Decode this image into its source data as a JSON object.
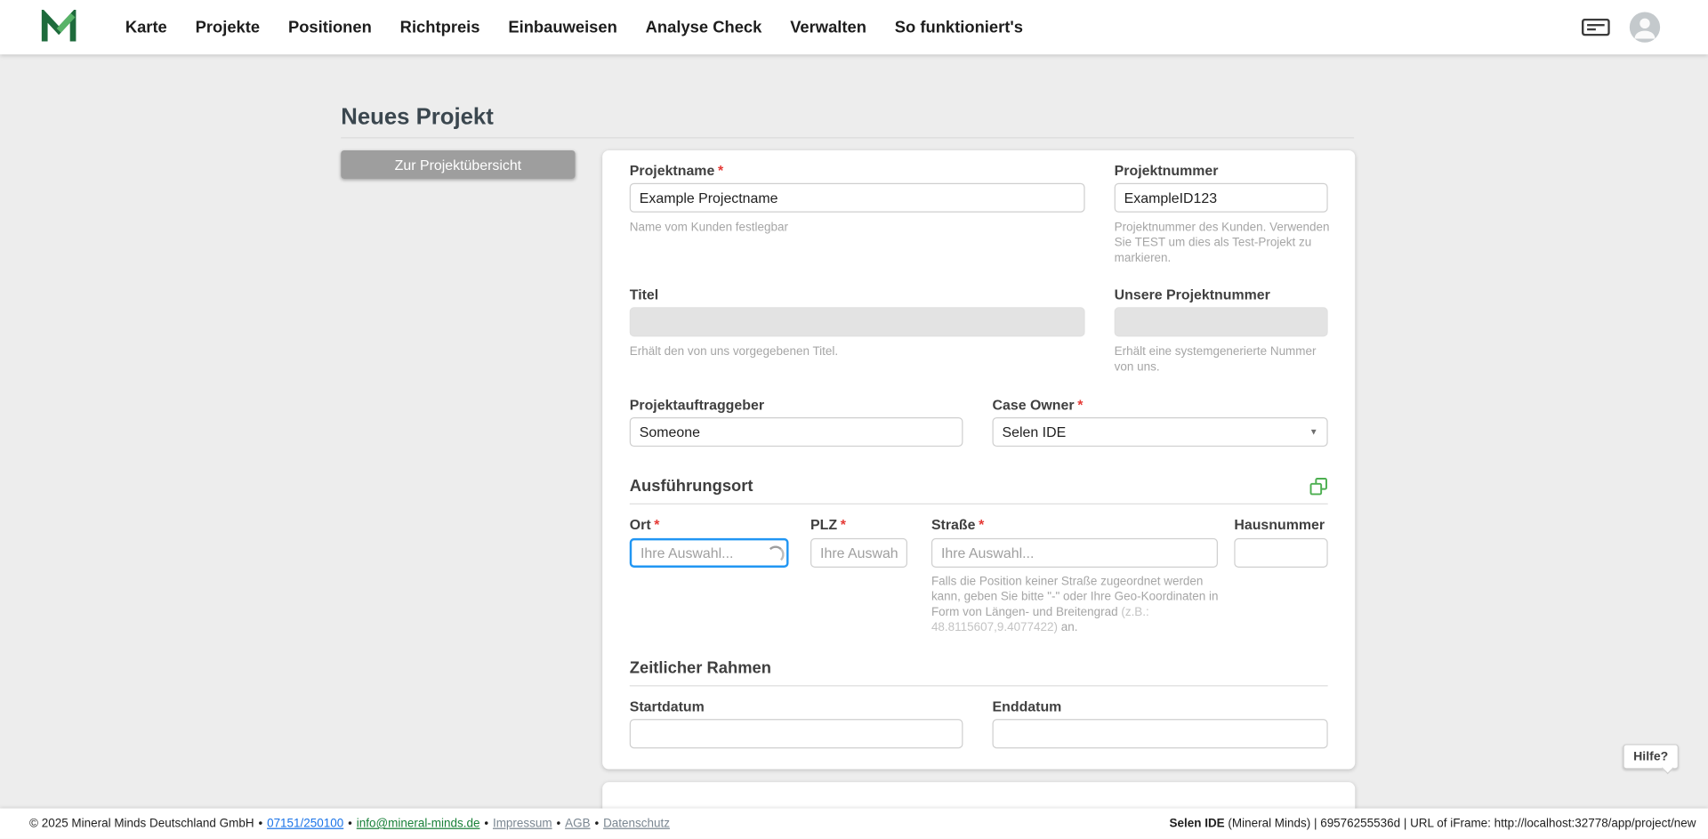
{
  "nav": {
    "items": [
      "Karte",
      "Projekte",
      "Positionen",
      "Richtpreis",
      "Einbauweisen",
      "Analyse Check",
      "Verwalten",
      "So funktioniert's"
    ]
  },
  "page": {
    "title": "Neues Projekt",
    "back_button_label": "Zur Projektübersicht",
    "required_marker": "*",
    "help_button_label": "Hilfe?"
  },
  "form": {
    "projektname": {
      "label": "Projektname",
      "value": "Example Projectname",
      "helper": "Name vom Kunden festlegbar"
    },
    "projektnummer": {
      "label": "Projektnummer",
      "value": "ExampleID123",
      "helper": "Projektnummer des Kunden. Verwenden Sie TEST um dies als Test-Projekt zu markieren."
    },
    "titel": {
      "label": "Titel",
      "value": "",
      "helper": "Erhält den von uns vorgegebenen Titel."
    },
    "unsere_projektnummer": {
      "label": "Unsere Projektnummer",
      "value": "",
      "helper": "Erhält eine systemgenerierte Nummer von uns."
    },
    "projektauftraggeber": {
      "label": "Projektauftraggeber",
      "value": "Someone"
    },
    "case_owner": {
      "label": "Case Owner",
      "value": "Selen IDE"
    },
    "sections": {
      "ausfuehrungsort": "Ausführungsort",
      "zeitlicher_rahmen": "Zeitlicher Rahmen"
    },
    "ort": {
      "label": "Ort",
      "placeholder": "Ihre Auswahl..."
    },
    "plz": {
      "label": "PLZ",
      "placeholder": "Ihre Auswahl."
    },
    "strasse": {
      "label": "Straße",
      "placeholder": "Ihre Auswahl...",
      "helper_part1": "Falls die Position keiner Straße zugeordnet werden kann, geben Sie bitte \"-\" oder Ihre Geo-Koordinaten in Form von Längen- und Breitengrad ",
      "helper_example": "(z.B.: 48.8115607,9.4077422)",
      "helper_part2": " an."
    },
    "hausnummer": {
      "label": "Hausnummer"
    },
    "startdatum": {
      "label": "Startdatum"
    },
    "enddatum": {
      "label": "Enddatum"
    }
  },
  "icons": {
    "caret": "▼"
  },
  "footer": {
    "copyright": "© 2025 Mineral Minds Deutschland GmbH",
    "sep": "•",
    "phone": "07151/250100",
    "email": "info@mineral-minds.de",
    "impressum": "Impressum",
    "agb": "AGB",
    "datenschutz": "Datenschutz",
    "user_bold": "Selen IDE",
    "user_rest": " (Mineral Minds) | 69576255536d | URL of iFrame: http://localhost:32778/app/project/new"
  }
}
